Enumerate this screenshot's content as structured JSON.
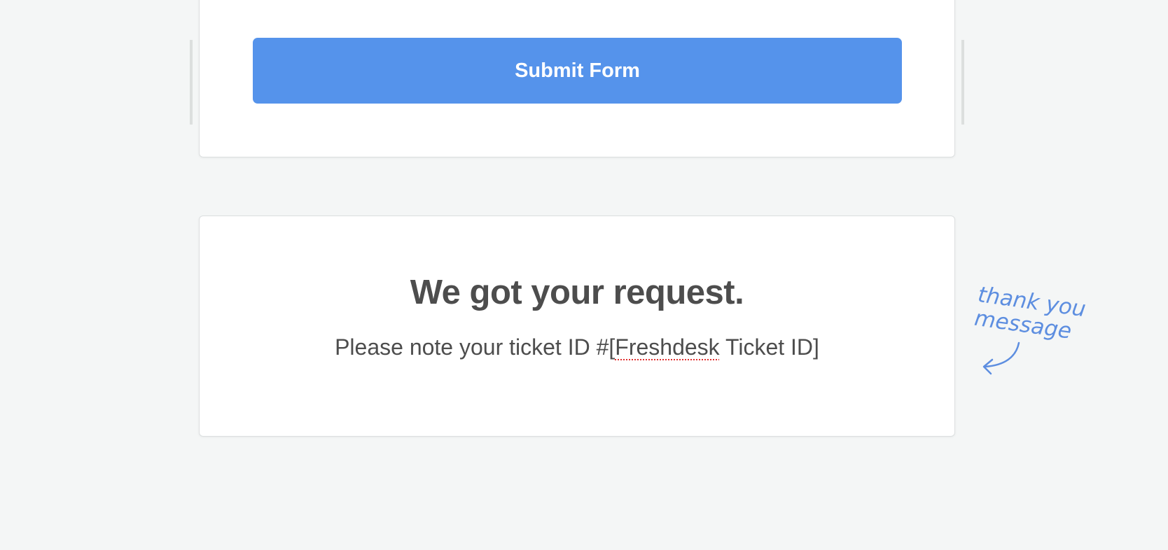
{
  "form": {
    "submit_label": "Submit Form"
  },
  "thank_you": {
    "title": "We got your request.",
    "message_prefix": "Please note your ticket ID #[",
    "message_flagged_word": "Freshdesk",
    "message_suffix": " Ticket ID]"
  },
  "annotation": {
    "line1": "thank you",
    "line2": "message",
    "icon": "curved-arrow-icon"
  },
  "colors": {
    "accent": "#5593eb",
    "annotation": "#5d8ee0",
    "background": "#f4f6f6",
    "text": "#4d4d4d"
  }
}
